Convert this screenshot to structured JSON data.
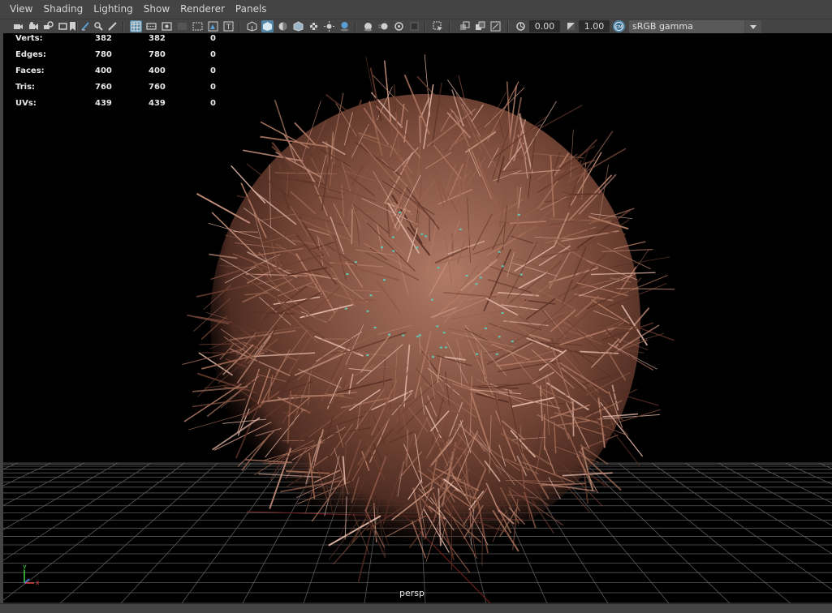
{
  "menu": [
    "View",
    "Shading",
    "Lighting",
    "Show",
    "Renderer",
    "Panels"
  ],
  "toolbar": {
    "exposure_value": "0.00",
    "gamma_value": "1.00",
    "color_management": "sRGB gamma",
    "active_tools": [
      "wireframe-on-shaded"
    ],
    "accent_color": "#5285a6"
  },
  "hud": {
    "rows": [
      {
        "label": "Verts:",
        "v1": "382",
        "v2": "382",
        "v3": "0"
      },
      {
        "label": "Edges:",
        "v1": "780",
        "v2": "780",
        "v3": "0"
      },
      {
        "label": "Faces:",
        "v1": "400",
        "v2": "400",
        "v3": "0"
      },
      {
        "label": "Tris:",
        "v1": "760",
        "v2": "760",
        "v3": "0"
      },
      {
        "label": "UVs:",
        "v1": "439",
        "v2": "439",
        "v3": "0"
      }
    ]
  },
  "viewport": {
    "camera": "persp",
    "background_color": "#000000",
    "object_color": "#8a5a4a",
    "axis_labels": {
      "x": "x",
      "y": "y"
    }
  }
}
